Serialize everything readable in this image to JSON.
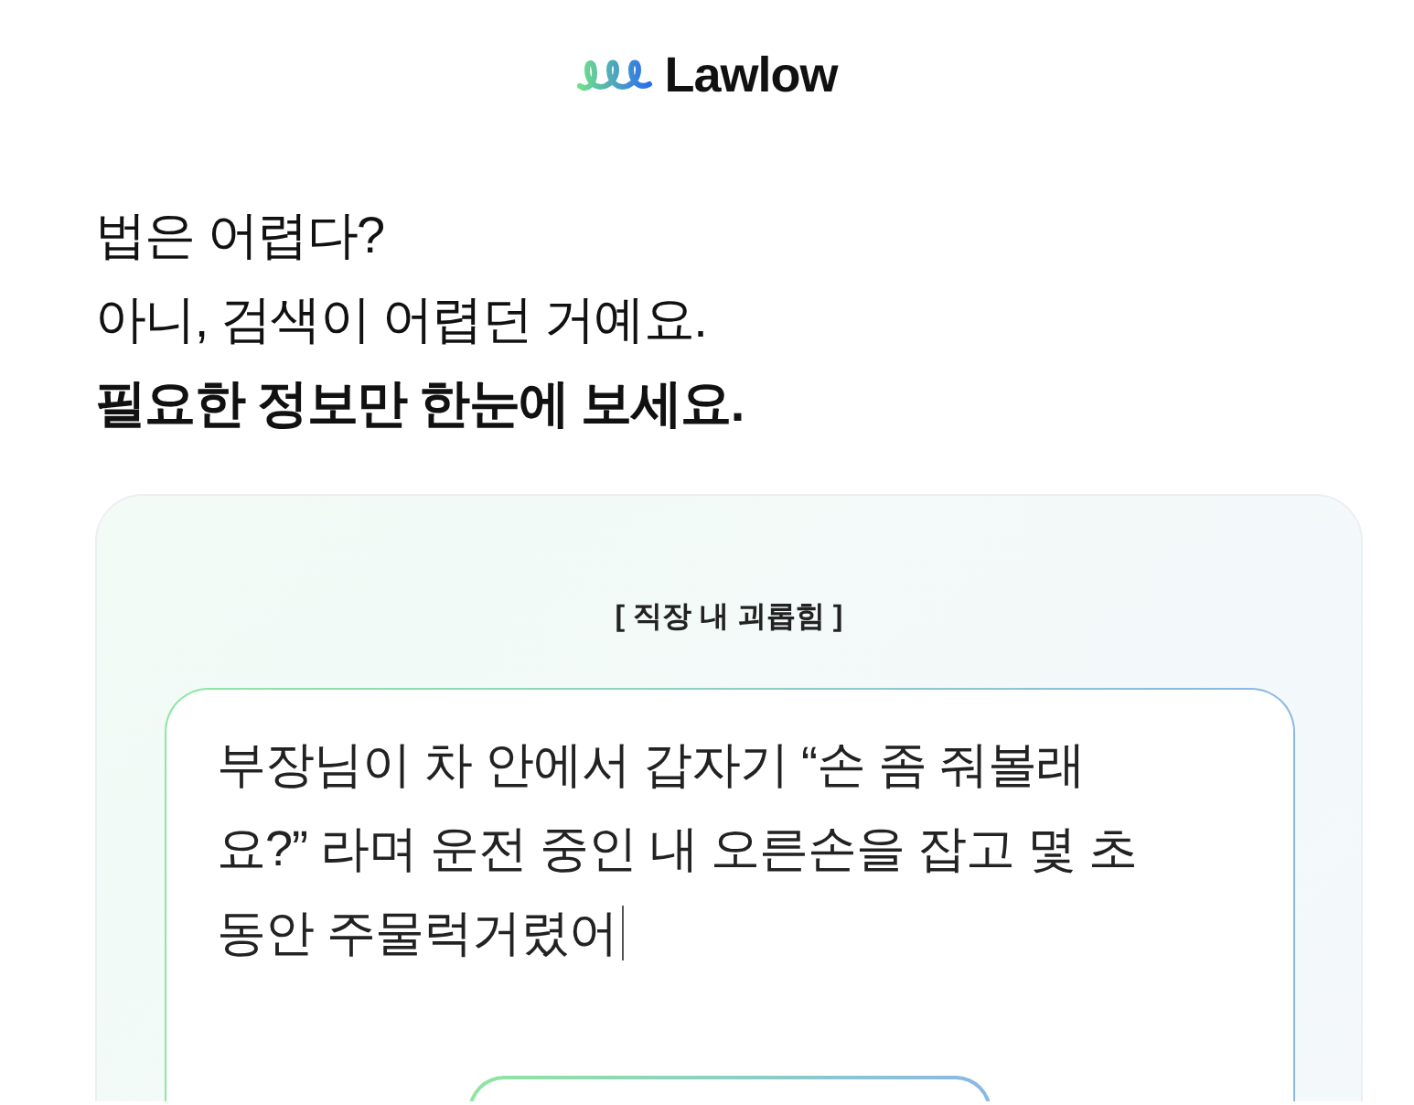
{
  "header": {
    "logo_text": "Lawlow"
  },
  "headline": {
    "lines": [
      {
        "text": "법은 어렵다?",
        "bold": false
      },
      {
        "text": "아니, 검색이 어렵던 거예요.",
        "bold": false
      },
      {
        "text": "필요한 정보만 한눈에 보세요.",
        "bold": true
      }
    ]
  },
  "card": {
    "category": "[ 직장 내 괴롭힘 ]",
    "input": {
      "value": "부장님이 차 안에서 갑자기 “손 좀 줘볼래요?” 라며 운전 중인 내 오른손을 잡고 몇 초 동안 주물럭거렸어",
      "focused": true
    }
  }
}
